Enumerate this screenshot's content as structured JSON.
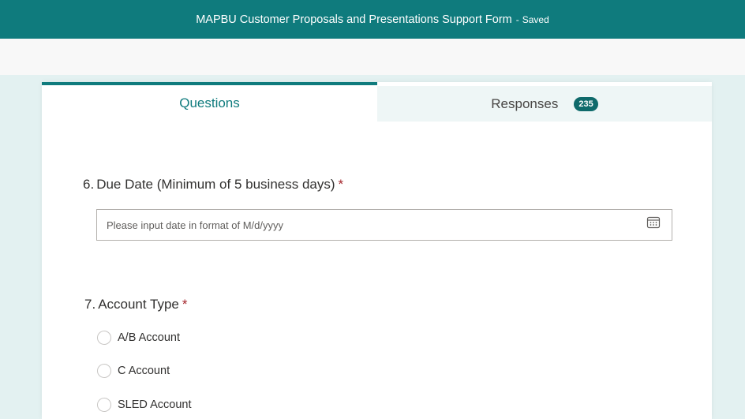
{
  "header": {
    "form_title": "MAPBU Customer Proposals and Presentations Support Form",
    "separator": "-",
    "status": "Saved"
  },
  "tabs": {
    "questions_label": "Questions",
    "responses_label": "Responses",
    "responses_count": "235"
  },
  "questions": [
    {
      "number": "6.",
      "title": "Due Date (Minimum of 5 business days)",
      "required_mark": "*",
      "input_placeholder": "Please input date in format of M/d/yyyy",
      "input_value": "",
      "icon": "calendar-icon"
    },
    {
      "number": "7.",
      "title": "Account Type",
      "required_mark": "*",
      "options": [
        "A/B Account",
        "C Account",
        "SLED Account"
      ]
    }
  ],
  "colors": {
    "brand": "#0f7b7d",
    "required": "#a4262c"
  }
}
